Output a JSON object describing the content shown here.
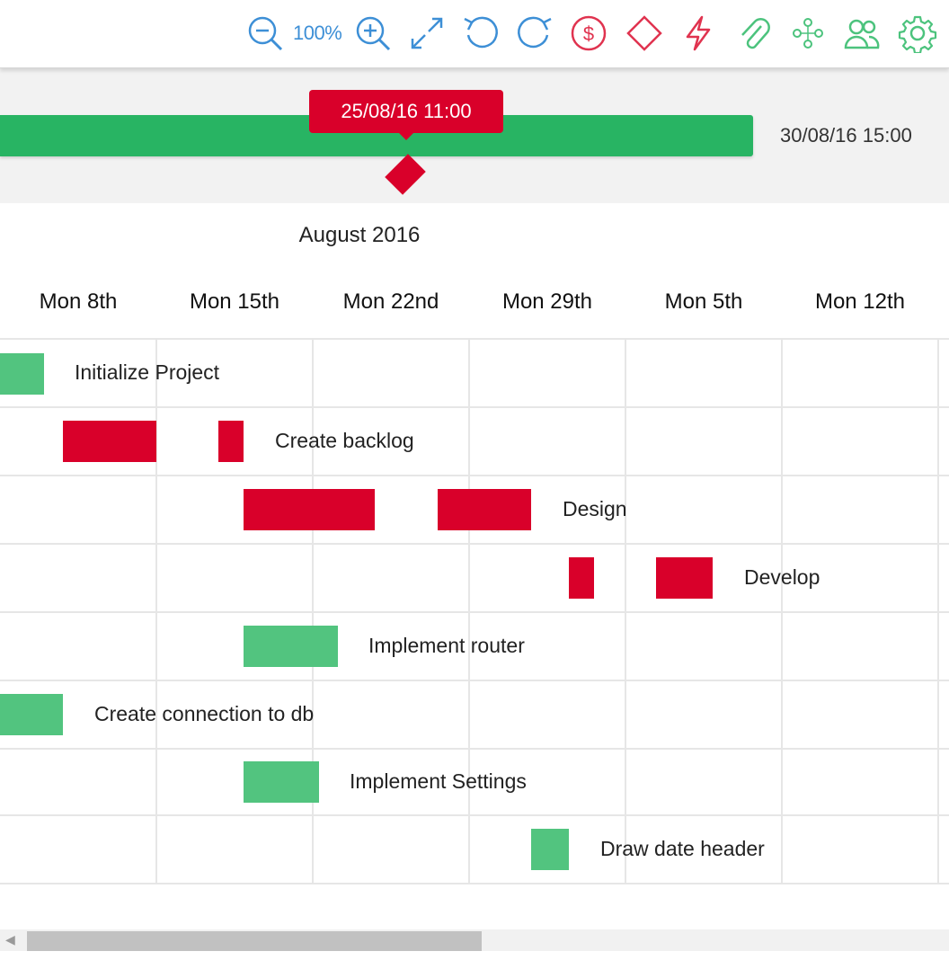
{
  "toolbar": {
    "zoom_level": "100%",
    "icons": [
      "zoom-out-icon",
      "zoom-in-icon",
      "fullscreen-icon",
      "undo-icon",
      "redo-icon",
      "dollar-icon",
      "diamond-icon",
      "lightning-icon",
      "paperclip-icon",
      "resource-icon",
      "users-icon",
      "gear-icon"
    ],
    "colors": {
      "blue": "#3d8fd6",
      "red": "#e0334f",
      "green": "#4cc37d"
    }
  },
  "timeline": {
    "current_date": "25/08/16 11:00",
    "end_date": "30/08/16 15:00",
    "bar_color": "#28b463",
    "marker_color": "#d9002a"
  },
  "chart_header": {
    "month": "August 2016",
    "weeks": [
      "Mon 8th",
      "Mon 15th",
      "Mon 22nd",
      "Mon 29th",
      "Mon 5th",
      "Mon 12th"
    ]
  },
  "tasks": [
    {
      "name": "Initialize Project",
      "color": "green"
    },
    {
      "name": "Create backlog",
      "color": "red"
    },
    {
      "name": "Design",
      "color": "red"
    },
    {
      "name": "Develop",
      "color": "red"
    },
    {
      "name": "Implement router",
      "color": "green"
    },
    {
      "name": "Create connection to db",
      "color": "green"
    },
    {
      "name": "Implement Settings",
      "color": "green"
    },
    {
      "name": "Draw date header",
      "color": "green"
    }
  ],
  "colors": {
    "green_task": "#52c47f",
    "red_task": "#d9002a"
  }
}
